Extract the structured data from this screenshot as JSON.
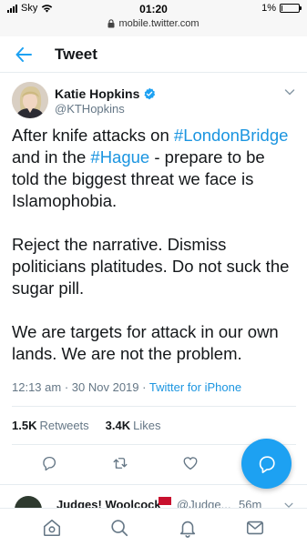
{
  "status_bar": {
    "carrier": "Sky",
    "time": "01:20",
    "url": "mobile.twitter.com",
    "battery_text": "1%",
    "battery_level": 0.05
  },
  "header": {
    "title": "Tweet"
  },
  "tweet": {
    "author_name": "Katie Hopkins",
    "author_handle": "@KTHopkins",
    "paragraphs": [
      [
        {
          "text": "After knife attacks on ",
          "hashtag": false
        },
        {
          "text": "#LondonBridge",
          "hashtag": true
        },
        {
          "text": " and in the ",
          "hashtag": false
        },
        {
          "text": "#Hague",
          "hashtag": true
        },
        {
          "text": " - prepare to be told the biggest threat we face is Islamophobia.",
          "hashtag": false
        }
      ],
      [
        {
          "text": "Reject the narrative. Dismiss politicians platitudes. Do not suck the sugar pill.",
          "hashtag": false
        }
      ],
      [
        {
          "text": "We are targets for attack in our own lands. We are not the problem.",
          "hashtag": false
        }
      ]
    ],
    "time": "12:13 am",
    "date": "30 Nov 2019",
    "separator": "·",
    "source": "Twitter for iPhone",
    "retweets_count": "1.5K",
    "retweets_label": "Retweets",
    "likes_count": "3.4K",
    "likes_label": "Likes"
  },
  "reply_preview": {
    "name": "Judges! Woolcock",
    "handle": "@Judge...",
    "time": "56m"
  },
  "colors": {
    "accent": "#1da1f2",
    "link": "#1b95e0",
    "secondary_text": "#657786",
    "verified": "#1da1f2"
  },
  "icons": {
    "back": "arrow-left-icon",
    "verified": "verified-badge-icon",
    "caret": "chevron-down-icon",
    "reply": "reply-icon",
    "retweet": "retweet-icon",
    "like": "heart-icon",
    "share": "share-icon",
    "compose": "compose-reply-icon",
    "home": "home-icon",
    "search": "search-icon",
    "notifications": "bell-icon",
    "messages": "envelope-icon"
  }
}
